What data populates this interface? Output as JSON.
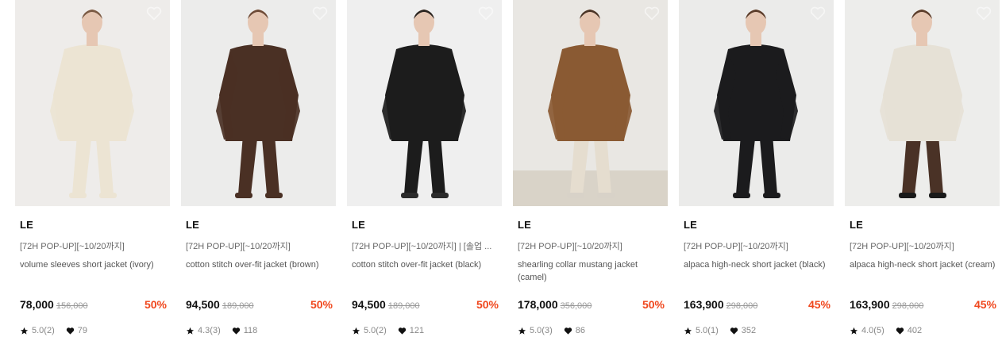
{
  "products": [
    {
      "brand": "LE",
      "promo": "[72H POP-UP][~10/20까지]",
      "name": "volume sleeves short jacket (ivory)",
      "price": "78,000",
      "original_price": "156,000",
      "discount": "50%",
      "rating": "5.0(2)",
      "likes": "79",
      "bg": "#eeecea",
      "garment": "#ece4d3",
      "pants": "#ece4d3",
      "hair": "#7a5a44",
      "shoes": "#ece4d3"
    },
    {
      "brand": "LE",
      "promo": "[72H POP-UP][~10/20까지]",
      "name": "cotton stitch over-fit jacket (brown)",
      "price": "94,500",
      "original_price": "189,000",
      "discount": "50%",
      "rating": "4.3(3)",
      "likes": "118",
      "bg": "#ececeb",
      "garment": "#4a3024",
      "pants": "#4a3024",
      "hair": "#6d4a36",
      "shoes": "#4a3024"
    },
    {
      "brand": "LE",
      "promo": "[72H POP-UP][~10/20까지] | [솔업 ...",
      "name": "cotton stitch over-fit jacket (black)",
      "price": "94,500",
      "original_price": "189,000",
      "discount": "50%",
      "rating": "5.0(2)",
      "likes": "121",
      "bg": "#efefef",
      "garment": "#1c1c1c",
      "pants": "#1c1c1c",
      "hair": "#2a2420",
      "shoes": "#2a2a2a"
    },
    {
      "brand": "LE",
      "promo": "[72H POP-UP][~10/20까지]",
      "name": "shearling collar mustang jacket (camel)",
      "price": "178,000",
      "original_price": "356,000",
      "discount": "50%",
      "rating": "5.0(3)",
      "likes": "86",
      "bg": "#e9e7e3",
      "garment": "#8a5a33",
      "pants": "#e5ddcf",
      "hair": "#4a3426",
      "shoes": "#d8d2c8"
    },
    {
      "brand": "LE",
      "promo": "[72H POP-UP][~10/20까지]",
      "name": "alpaca high-neck short jacket (black)",
      "price": "163,900",
      "original_price": "298,000",
      "discount": "45%",
      "rating": "5.0(1)",
      "likes": "352",
      "bg": "#ebebea",
      "garment": "#1b1b1d",
      "pants": "#1b1b1d",
      "hair": "#5a3c2a",
      "shoes": "#1b1b1d"
    },
    {
      "brand": "LE",
      "promo": "[72H POP-UP][~10/20까지]",
      "name": "alpaca high-neck short jacket (cream)",
      "price": "163,900",
      "original_price": "298,000",
      "discount": "45%",
      "rating": "4.0(5)",
      "likes": "402",
      "bg": "#ededeb",
      "garment": "#e6e1d6",
      "pants": "#4a3226",
      "hair": "#5a3c2a",
      "shoes": "#1a1a1a"
    }
  ]
}
